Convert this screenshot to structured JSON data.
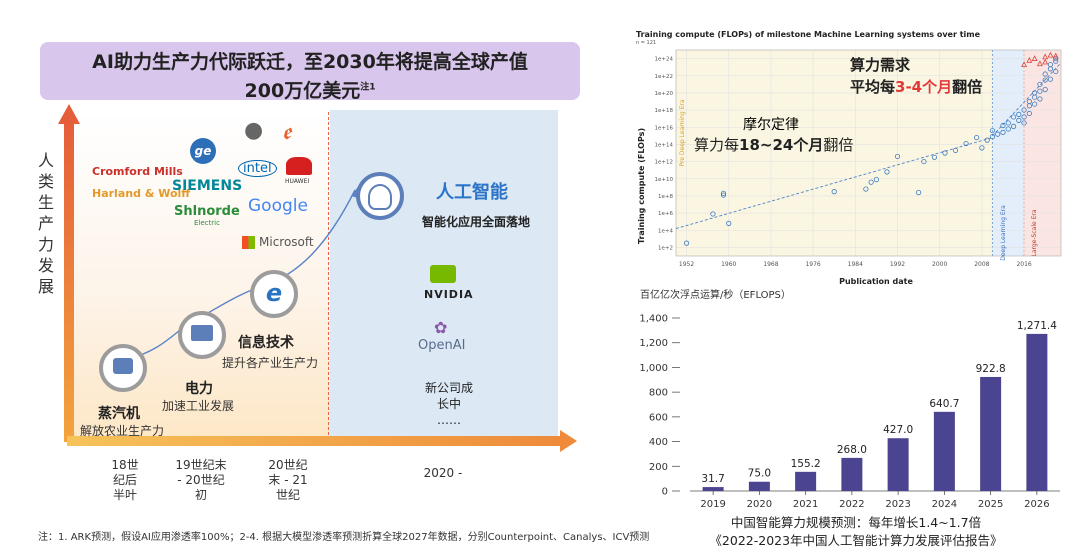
{
  "left": {
    "banner": {
      "line1": "AI助力生产力代际跃迁，至2030年将提高全球产值",
      "line2": "200万亿美元",
      "note": "注1"
    },
    "vertical_label": "人类生产力发展",
    "companies": {
      "steam": [
        "Cromford Mills",
        "Harland & Wolff"
      ],
      "electric": [
        "SIEMENS",
        "Shlnorde"
      ],
      "electric_sub": "Electric",
      "it": [
        "intel",
        "HUAWEI",
        "Google",
        "Microsoft"
      ],
      "ai": [
        "NVIDIA",
        "OpenAI"
      ]
    },
    "eras": [
      {
        "title": "蒸汽机",
        "sub": "解放农业生产力"
      },
      {
        "title": "电力",
        "sub": "加速工业发展"
      },
      {
        "title": "信息技术",
        "sub": "提升各产业生产力"
      },
      {
        "title": "人工智能",
        "sub": "智能化应用全面落地"
      }
    ],
    "new_companies": [
      "新公司成",
      "长中",
      "……"
    ],
    "x_labels": [
      [
        "18世",
        "纪后",
        "半叶"
      ],
      [
        "19世纪末",
        "- 20世纪",
        "初"
      ],
      [
        "20世纪",
        "末 - 21",
        "世纪"
      ],
      [
        "2020 -"
      ]
    ],
    "footnote": "注：1. ARK预测，假设AI应用渗透率100%；2-4. 根据大模型渗透率预测折算全球2027年数据，分别Counterpoint、Canalys、ICV预测"
  },
  "chart_data": [
    {
      "type": "scatter",
      "title": "Training compute (FLOPs) of milestone Machine Learning systems over time",
      "subtitle": "n = 121",
      "xlabel": "Publication date",
      "ylabel": "Training compute (FLOPs)",
      "x_ticks": [
        1952,
        1960,
        1968,
        1976,
        1984,
        1992,
        2000,
        2008,
        2016
      ],
      "y_ticks": [
        "1e+2",
        "1e+4",
        "1e+6",
        "1e+8",
        "1e+10",
        "1e+12",
        "1e+14",
        "1e+16",
        "1e+18",
        "1e+20",
        "1e+22",
        "1e+24"
      ],
      "xlim": [
        1950,
        2023
      ],
      "ylim_log10": [
        1,
        25
      ],
      "regions": [
        "Pre Deep Learning Era",
        "Deep Learning Era",
        "Large-Scale Era"
      ],
      "annotations": [
        {
          "line1": "摩尔定律",
          "line2_pre": "算力每",
          "line2_hl": "18~24个月",
          "line2_post": "翻倍"
        },
        {
          "line1": "算力需求",
          "line2_pre": "平均每",
          "line2_hl": "3-4个月",
          "line2_post": "翻倍"
        }
      ],
      "points": [
        [
          1952,
          2.5
        ],
        [
          1957,
          5.9
        ],
        [
          1959,
          8.3
        ],
        [
          1959,
          8.1
        ],
        [
          1960,
          4.8
        ],
        [
          1980,
          8.5
        ],
        [
          1986,
          8.8
        ],
        [
          1987,
          9.6
        ],
        [
          1988,
          9.9
        ],
        [
          1990,
          10.8
        ],
        [
          1992,
          12.6
        ],
        [
          1996,
          8.4
        ],
        [
          1997,
          12.0
        ],
        [
          1999,
          12.5
        ],
        [
          2001,
          13.0
        ],
        [
          2003,
          13.3
        ],
        [
          2005,
          14.1
        ],
        [
          2007,
          14.8
        ],
        [
          2008,
          13.6
        ],
        [
          2009,
          14.5
        ],
        [
          2010,
          15.6
        ],
        [
          2010,
          14.9
        ],
        [
          2011,
          15.2
        ],
        [
          2012,
          16.2
        ],
        [
          2012,
          15.4
        ],
        [
          2013,
          15.8
        ],
        [
          2013,
          16.5
        ],
        [
          2014,
          17.2
        ],
        [
          2014,
          16.1
        ],
        [
          2015,
          17.5
        ],
        [
          2015,
          16.8
        ],
        [
          2016,
          18.0
        ],
        [
          2016,
          17.2
        ],
        [
          2016,
          16.5
        ],
        [
          2017,
          18.5
        ],
        [
          2017,
          19.0
        ],
        [
          2017,
          17.6
        ],
        [
          2018,
          19.5
        ],
        [
          2018,
          18.7
        ],
        [
          2018,
          20.0
        ],
        [
          2019,
          20.2
        ],
        [
          2019,
          21.0
        ],
        [
          2019,
          19.3
        ],
        [
          2020,
          21.5
        ],
        [
          2020,
          22.2
        ],
        [
          2020,
          20.4
        ],
        [
          2021,
          22.8
        ],
        [
          2021,
          23.3
        ],
        [
          2021,
          21.6
        ],
        [
          2022,
          23.7
        ],
        [
          2022,
          22.5
        ],
        [
          2022,
          24.0
        ]
      ],
      "large_scale_points": [
        [
          2016,
          23.3
        ],
        [
          2017,
          23.8
        ],
        [
          2018,
          24.0
        ],
        [
          2019,
          23.4
        ],
        [
          2020,
          24.2
        ],
        [
          2020,
          23.6
        ],
        [
          2021,
          24.4
        ],
        [
          2022,
          24.3
        ]
      ]
    },
    {
      "type": "bar",
      "ylabel": "百亿亿次浮点运算/秒（EFLOPS）",
      "categories": [
        "2019",
        "2020",
        "2021",
        "2022",
        "2023",
        "2024",
        "2025",
        "2026"
      ],
      "values": [
        31.7,
        75.0,
        155.2,
        268.0,
        427.0,
        640.7,
        922.8,
        1271.4
      ],
      "value_labels": [
        "31.7",
        "75.0",
        "155.2",
        "268.0",
        "427.0",
        "640.7",
        "922.8",
        "1,271.4"
      ],
      "ylim": [
        0,
        1400
      ],
      "y_ticks": [
        "0",
        "200",
        "400",
        "600",
        "800",
        "1,000",
        "1,200",
        "1,400"
      ],
      "caption1": "中国智能算力规模预测：每年增长1.4~1.7倍",
      "caption2": "《2022-2023年中国人工智能计算力发展评估报告》",
      "bar_color": "#4b4490"
    }
  ]
}
